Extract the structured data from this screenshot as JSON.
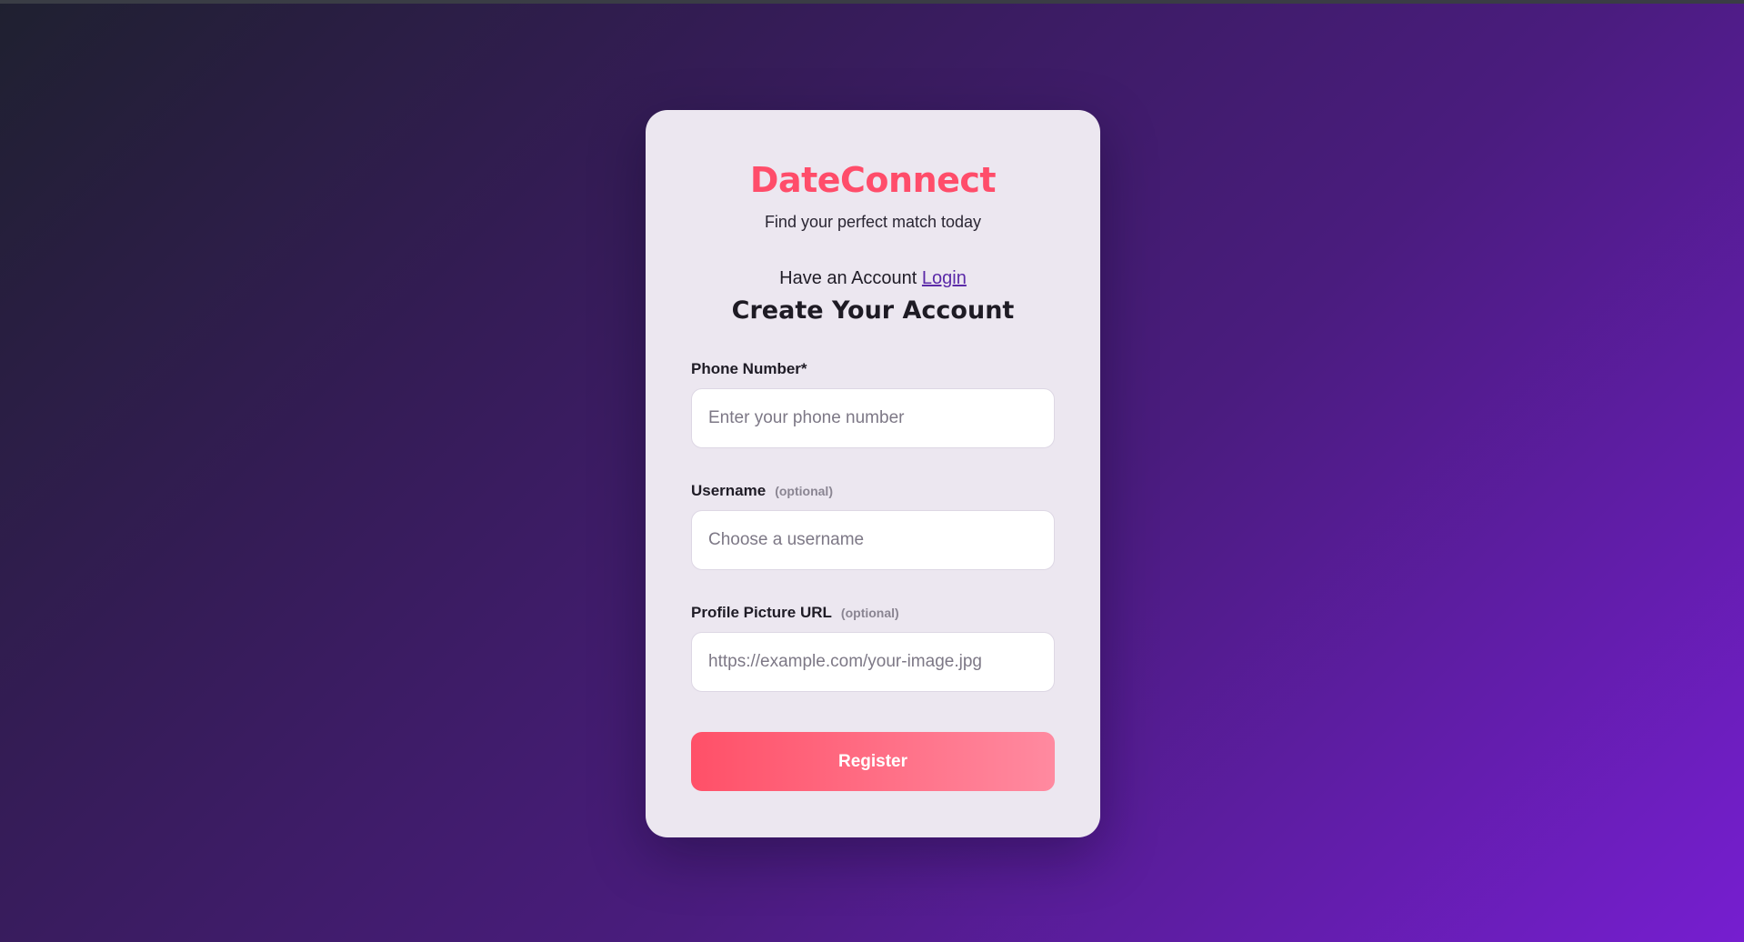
{
  "brand": {
    "name": "DateConnect",
    "tagline": "Find your perfect match today"
  },
  "auth": {
    "have_account_text": "Have an Account",
    "login_link": "Login"
  },
  "form": {
    "heading": "Create Your Account",
    "fields": [
      {
        "label": "Phone Number*",
        "optional": "",
        "placeholder": "Enter your phone number",
        "value": ""
      },
      {
        "label": "Username",
        "optional": "(optional)",
        "placeholder": "Choose a username",
        "value": ""
      },
      {
        "label": "Profile Picture URL",
        "optional": "(optional)",
        "placeholder": "https://example.com/your-image.jpg",
        "value": ""
      }
    ],
    "submit_label": "Register"
  },
  "colors": {
    "brand": "#ff4d6a",
    "link": "#5b2aa8",
    "card_bg": "#ece7f0",
    "button_gradient_start": "#ff5068",
    "button_gradient_end": "#ff8aa0"
  }
}
